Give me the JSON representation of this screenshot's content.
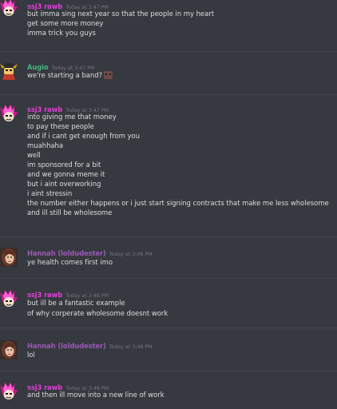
{
  "colors": {
    "background": "#36393f",
    "divider": "#42454a",
    "ssj3_name": "#e03fd8",
    "augio_name": "#43b581",
    "hannah_name": "#9b59b6",
    "message_text": "#dcddde",
    "timestamp": "#72767d"
  },
  "messages": [
    {
      "author": "ssj3 rawb",
      "avatar": "ssj3-avatar",
      "timestamp": "Today at 3:47 PM",
      "lines": [
        "but imma sing next year so that the people in my heart",
        "get some more money",
        "imma trick you guys"
      ]
    },
    {
      "author": "Augio",
      "avatar": "augio-avatar",
      "timestamp": "Today at 3:47 PM",
      "lines": [
        "we're starting a band?"
      ],
      "emoji": "pig-face-emoji"
    },
    {
      "author": "ssj3 rawb",
      "avatar": "ssj3-avatar",
      "timestamp": "Today at 3:47 PM",
      "lines": [
        "into giving me that money",
        "to pay these people",
        "and if i cant get enough from you",
        "muahhaha",
        "well",
        "im sponsored for a bit",
        "and we gonna meme it",
        "but i aint overworking",
        "i aint stressin",
        "the number either happens or i just start signing contracts that make me less wholesome",
        "and ill still be wholesome"
      ]
    },
    {
      "author": "Hannah (loldudester)",
      "avatar": "hannah-avatar",
      "timestamp": "Today at 3:48 PM",
      "lines": [
        "ye health comes first imo"
      ]
    },
    {
      "author": "ssj3 rawb",
      "avatar": "ssj3-avatar",
      "timestamp": "Today at 3:48 PM",
      "lines": [
        "but ill be a fantastic example",
        "of why corperate wholesome doesnt work"
      ]
    },
    {
      "author": "Hannah (loldudester)",
      "avatar": "hannah-avatar",
      "timestamp": "Today at 3:48 PM",
      "lines": [
        "lol"
      ]
    },
    {
      "author": "ssj3 rawb",
      "avatar": "ssj3-avatar",
      "timestamp": "Today at 3:48 PM",
      "lines": [
        "and then ill move into a new line of work"
      ]
    }
  ]
}
